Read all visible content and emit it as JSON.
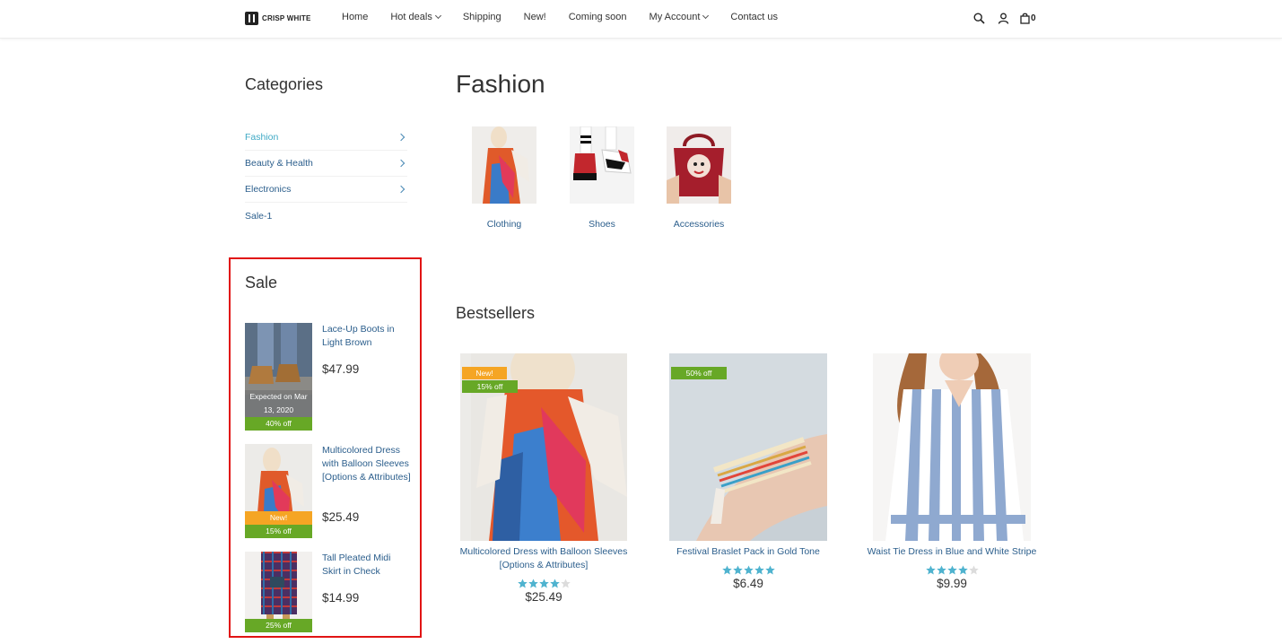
{
  "header": {
    "brand": "CRISP WHITE",
    "nav": [
      {
        "label": "Home",
        "dropdown": false
      },
      {
        "label": "Hot deals",
        "dropdown": true
      },
      {
        "label": "Shipping",
        "dropdown": false
      },
      {
        "label": "New!",
        "dropdown": false
      },
      {
        "label": "Coming soon",
        "dropdown": false
      },
      {
        "label": "My Account",
        "dropdown": true
      },
      {
        "label": "Contact us",
        "dropdown": false
      }
    ],
    "cart_count": "0"
  },
  "sidebar": {
    "categories_title": "Categories",
    "categories": [
      {
        "label": "Fashion",
        "active": true,
        "has_children": true
      },
      {
        "label": "Beauty & Health",
        "active": false,
        "has_children": true
      },
      {
        "label": "Electronics",
        "active": false,
        "has_children": true
      },
      {
        "label": "Sale-1",
        "active": false,
        "has_children": false
      }
    ],
    "sale_title": "Sale",
    "sale_items": [
      {
        "name": "Lace-Up Boots in Light Brown",
        "price": "$47.99",
        "expected": "Expected on Mar 13, 2020",
        "badges": [
          "40% off"
        ]
      },
      {
        "name": "Multicolored Dress with Balloon Sleeves [Options & Attributes]",
        "price": "$25.49",
        "badges": [
          "New!",
          "15% off"
        ]
      },
      {
        "name": "Tall Pleated Midi Skirt in Check",
        "price": "$14.99",
        "badges": [
          "25% off"
        ]
      }
    ]
  },
  "main": {
    "title": "Fashion",
    "subcategories": [
      {
        "label": "Clothing"
      },
      {
        "label": "Shoes"
      },
      {
        "label": "Accessories"
      }
    ],
    "bestsellers_title": "Bestsellers",
    "products": [
      {
        "name": "Multicolored Dress with Balloon Sleeves [Options & Attributes]",
        "price": "$25.49",
        "rating": 4,
        "badges": [
          "New!",
          "15% off"
        ]
      },
      {
        "name": "Festival Braslet Pack in Gold Tone",
        "price": "$6.49",
        "rating": 5,
        "badges": [
          "50% off"
        ]
      },
      {
        "name": "Waist Tie Dress in Blue and White Stripe",
        "price": "$9.99",
        "rating": 4,
        "badges": []
      }
    ]
  },
  "colors": {
    "link": "#2b5e8c",
    "active_link": "#3fa9c5",
    "badge_green": "#67a826",
    "badge_orange": "#f5a524",
    "star": "#4fb3cf",
    "highlight_border": "#e11414"
  }
}
